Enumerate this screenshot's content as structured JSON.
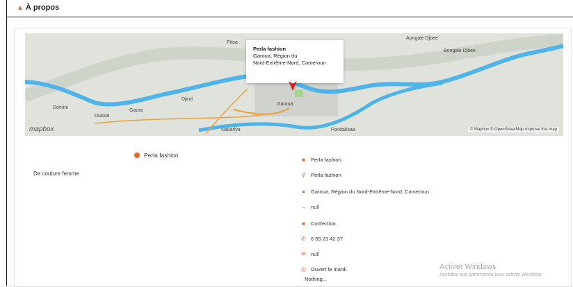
{
  "header": {
    "title": "À propos",
    "icon": "user-icon"
  },
  "map": {
    "labels": [
      "Pitoa",
      "Aongale Djbee",
      "Bongale Djbee",
      "Domini",
      "Gaura",
      "Djirol",
      "Dukkal",
      "Garoua",
      "Nakarlya",
      "Fondakkaa"
    ],
    "logo_text": "mapbox",
    "attribution": "© Mapbox © OpenStreetMap Improve this map",
    "popup": {
      "name": "Perla fashion",
      "line2": "Garoua, Région du",
      "line3": "Nord-Extrême-Nord, Cameroun"
    }
  },
  "about": {
    "description": "De couture femme",
    "seller_name": "Perla fashion"
  },
  "details": [
    {
      "icon": "store-icon",
      "text": "Perla fashion"
    },
    {
      "icon": "search-icon",
      "text": "Perla fashion"
    },
    {
      "icon": "location-pin-icon",
      "text": "Garoua, Région du Nord-Extrême-Nord, Cameroun"
    },
    {
      "icon": "link-icon",
      "text": "null"
    },
    {
      "icon": "category-icon",
      "text": "Confection"
    },
    {
      "icon": "phone-icon",
      "text": "6 55 23 42 37"
    },
    {
      "icon": "mail-icon",
      "text": "null"
    },
    {
      "icon": "clock-icon",
      "text": "Ouvert le mardi"
    },
    {
      "icon": "",
      "text": "Nothing..."
    }
  ],
  "watermark": {
    "line1": "Activer Windows",
    "line2": "Accédez aux paramètres pour activer Windows."
  },
  "colors": {
    "accent": "#e8672c",
    "river": "#4fb3e8",
    "map_bg": "#dfe3dc"
  }
}
